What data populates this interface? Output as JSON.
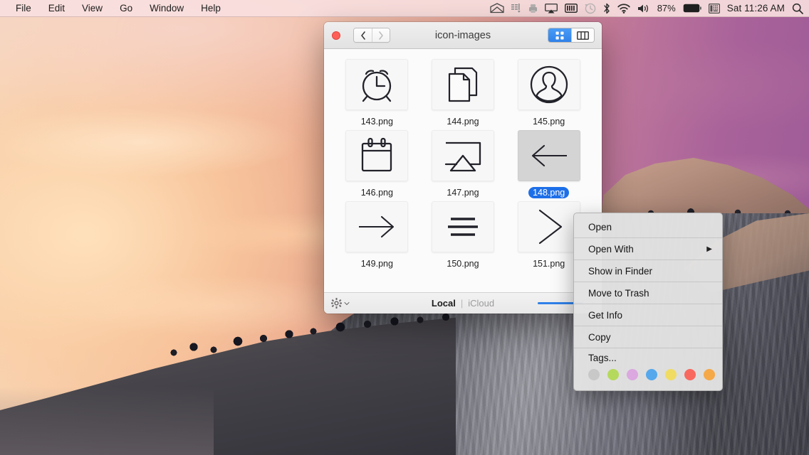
{
  "menubar": {
    "app_menus": [
      {
        "label": "File"
      },
      {
        "label": "Edit"
      },
      {
        "label": "View"
      },
      {
        "label": "Go"
      },
      {
        "label": "Window"
      },
      {
        "label": "Help"
      }
    ],
    "status_icons": [
      {
        "name": "mail-envelope-icon"
      },
      {
        "name": "dropbox-icon"
      },
      {
        "name": "printer-icon"
      },
      {
        "name": "airplay-icon"
      },
      {
        "name": "battery-meter-icon"
      },
      {
        "name": "time-machine-icon"
      },
      {
        "name": "bluetooth-icon"
      },
      {
        "name": "wifi-icon"
      },
      {
        "name": "volume-icon"
      }
    ],
    "battery_percent": "87%",
    "input_source_icon": "keyboard-input-icon",
    "clock": "Sat 11:26 AM",
    "spotlight_icon": "search-icon"
  },
  "finder": {
    "title": "icon-images",
    "nav": {
      "back_label": "‹",
      "forward_label": "›"
    },
    "view_modes": [
      {
        "name": "icon-view",
        "active": true
      },
      {
        "name": "column-view",
        "active": false
      }
    ],
    "files": [
      {
        "name": "143.png",
        "icon": "alarm-clock-icon",
        "selected": false
      },
      {
        "name": "144.png",
        "icon": "copy-documents-icon",
        "selected": false
      },
      {
        "name": "145.png",
        "icon": "user-profile-icon",
        "selected": false
      },
      {
        "name": "146.png",
        "icon": "calendar-icon",
        "selected": false
      },
      {
        "name": "147.png",
        "icon": "airplay-icon",
        "selected": false
      },
      {
        "name": "148.png",
        "icon": "arrow-left-icon",
        "selected": true
      },
      {
        "name": "149.png",
        "icon": "arrow-right-icon",
        "selected": false
      },
      {
        "name": "150.png",
        "icon": "hamburger-menu-icon",
        "selected": false
      },
      {
        "name": "151.png",
        "icon": "chevron-right-icon",
        "selected": false
      }
    ],
    "statusbar": {
      "gear_icon": "gear-action-icon",
      "location_local": "Local",
      "location_divider": "|",
      "location_icloud": "iCloud",
      "zoom_value": 88
    }
  },
  "context_menu": {
    "items": [
      {
        "label": "Open",
        "has_submenu": false
      },
      {
        "label": "Open With",
        "has_submenu": true
      },
      {
        "label": "Show in Finder",
        "has_submenu": false
      },
      {
        "label": "Move to Trash",
        "has_submenu": false
      },
      {
        "label": "Get Info",
        "has_submenu": false
      },
      {
        "label": "Copy",
        "has_submenu": false
      }
    ],
    "submenu_arrow": "▶",
    "tags_label": "Tags...",
    "tag_colors": [
      "#c8c8c8",
      "#b5d95c",
      "#dba8e0",
      "#55a8ec",
      "#f0dc63",
      "#f9685f",
      "#f5a949"
    ]
  }
}
